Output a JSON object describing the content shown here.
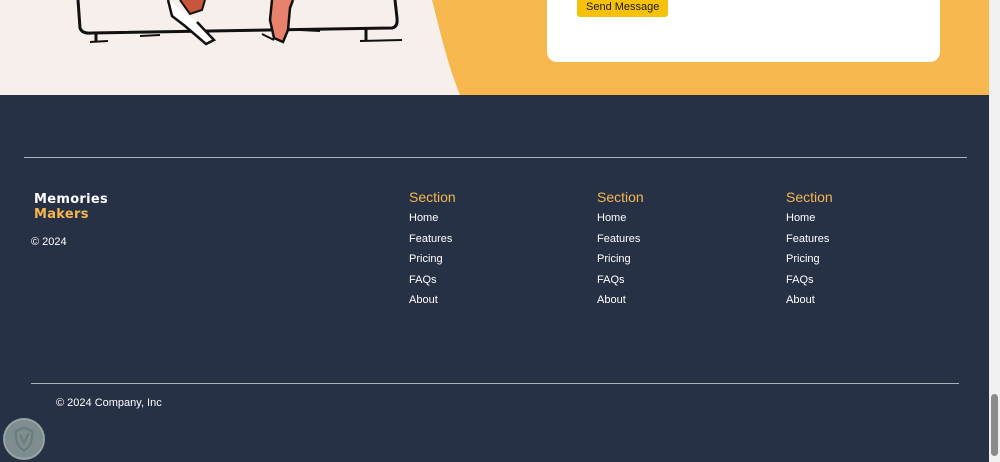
{
  "contact": {
    "send_label": "Send Message"
  },
  "brand": {
    "line1": "Memories",
    "line2": "Makers"
  },
  "footer": {
    "copyright_small": "© 2024",
    "columns": [
      {
        "title": "Section",
        "links": [
          "Home",
          "Features",
          "Pricing",
          "FAQs",
          "About"
        ]
      },
      {
        "title": "Section",
        "links": [
          "Home",
          "Features",
          "Pricing",
          "FAQs",
          "About"
        ]
      },
      {
        "title": "Section",
        "links": [
          "Home",
          "Features",
          "Pricing",
          "FAQs",
          "About"
        ]
      }
    ],
    "copyright_bottom": "© 2024 Company, Inc"
  },
  "colors": {
    "accent": "#f5b74e",
    "footer_bg": "#273146",
    "button": "#f6c10b",
    "illustration_bg": "#f7efec"
  }
}
